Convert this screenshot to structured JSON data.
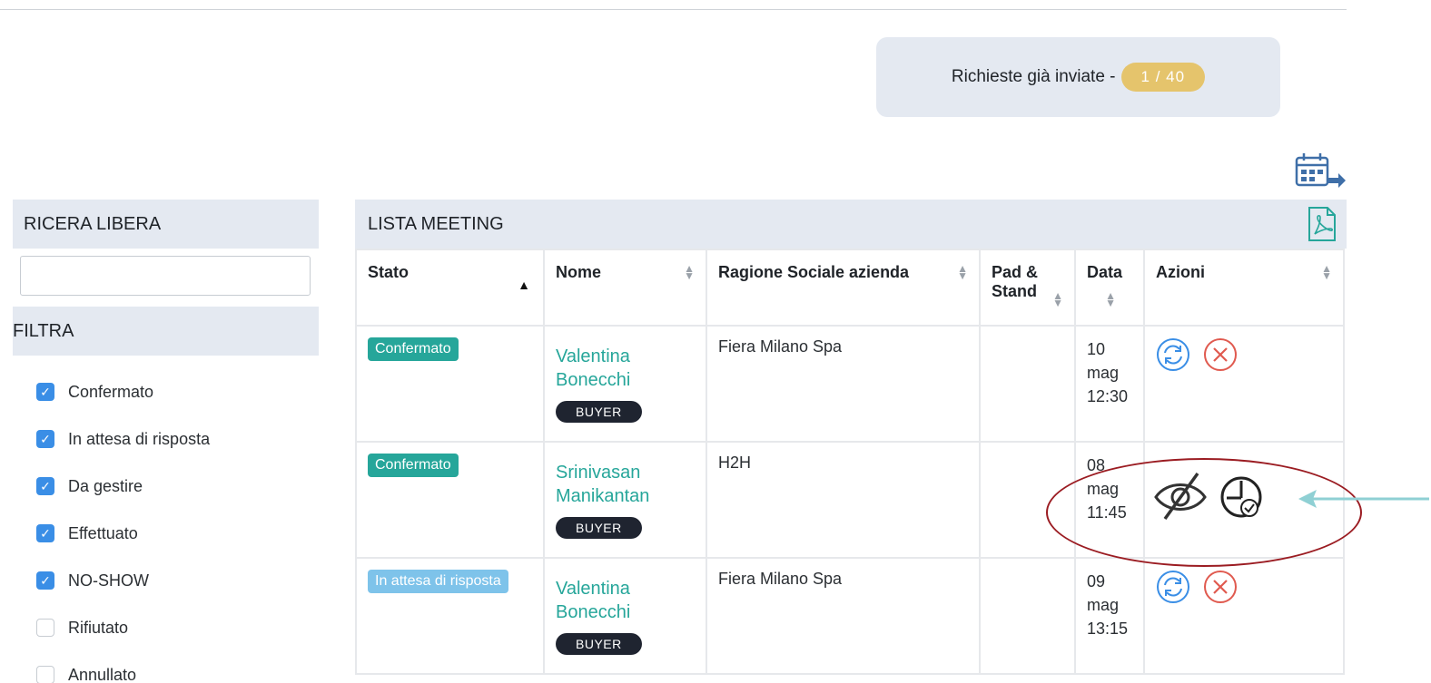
{
  "requests": {
    "label": "Richieste già inviate -",
    "count": "1 / 40"
  },
  "sidebar": {
    "search_title": "RICERA LIBERA",
    "search_value": "",
    "filter_title": "FILTRA",
    "filters": [
      {
        "label": "Confermato",
        "checked": true
      },
      {
        "label": "In attesa di risposta",
        "checked": true
      },
      {
        "label": "Da gestire",
        "checked": true
      },
      {
        "label": "Effettuato",
        "checked": true
      },
      {
        "label": "NO-SHOW",
        "checked": true
      },
      {
        "label": "Rifiutato",
        "checked": false
      },
      {
        "label": "Annullato",
        "checked": false
      }
    ]
  },
  "meetings": {
    "title": "LISTA MEETING",
    "columns": [
      "Stato",
      "Nome",
      "Ragione Sociale azienda",
      "Pad & Stand",
      "Data",
      "Azioni"
    ],
    "rows": [
      {
        "status": "Confermato",
        "status_color": "#26a69a",
        "name": "Valentina Bonecchi",
        "role": "BUYER",
        "company": "Fiera Milano Spa",
        "pad_stand": "",
        "date_day": "10",
        "date_month": "mag",
        "date_time": "12:30",
        "actions": [
          "refresh-icon",
          "cancel-icon"
        ]
      },
      {
        "status": "Confermato",
        "status_color": "#26a69a",
        "name": "Srinivasan Manikantan",
        "role": "BUYER",
        "company": "H2H",
        "pad_stand": "",
        "date_day": "08",
        "date_month": "mag",
        "date_time": "11:45",
        "actions": [
          "hide-icon",
          "clock-check-icon"
        ]
      },
      {
        "status": "In attesa di risposta",
        "status_color": "#7ec3ea",
        "name": "Valentina Bonecchi",
        "role": "BUYER",
        "company": "Fiera Milano Spa",
        "pad_stand": "",
        "date_day": "09",
        "date_month": "mag",
        "date_time": "13:15",
        "actions": [
          "refresh-icon",
          "cancel-icon"
        ]
      }
    ]
  },
  "colors": {
    "accent": "#26a69a",
    "badge": "#e5c46c",
    "panel": "#e4e9f1",
    "annotation": "#9b1c22",
    "arrow": "#8fd0d4"
  }
}
